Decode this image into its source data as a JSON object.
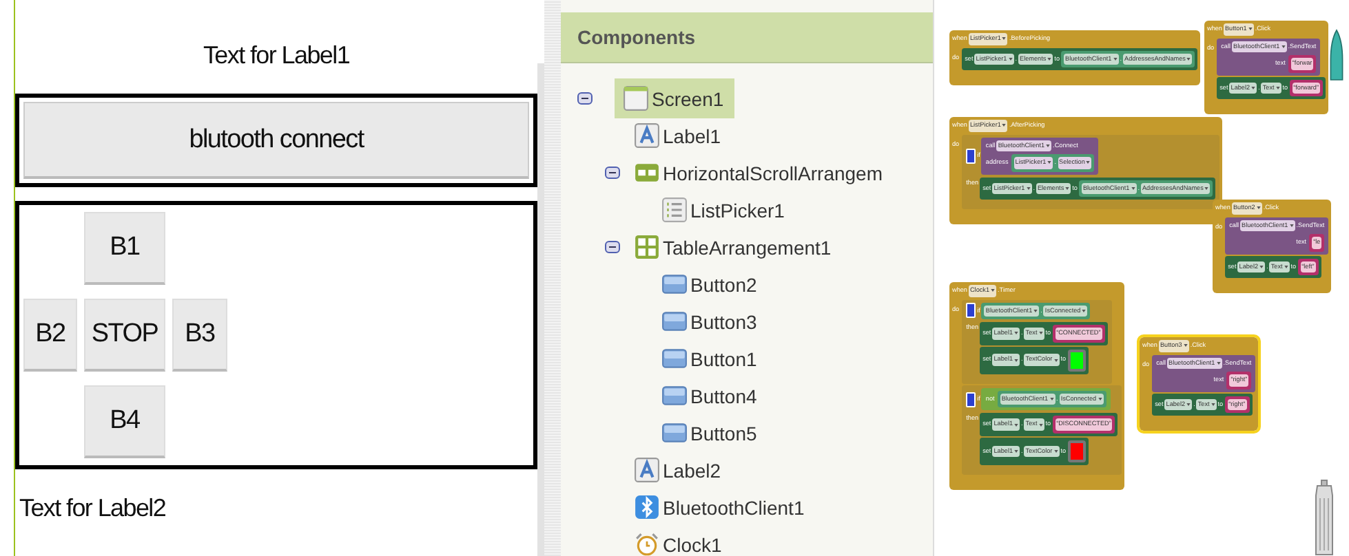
{
  "viewer": {
    "label1": "Text for Label1",
    "connect_button": "blutooth connect",
    "table_buttons": [
      "B1",
      "B2",
      "STOP",
      "B3",
      "B4"
    ],
    "label2": "Text for Label2"
  },
  "components": {
    "title": "Components",
    "tree": [
      {
        "name": "Screen1",
        "kind": "screen",
        "selected": true,
        "expanded": true,
        "children": [
          {
            "name": "Label1",
            "kind": "label",
            "selected": false
          },
          {
            "name": "HorizontalScrollArrangem",
            "kind": "horizontal",
            "selected": false,
            "expanded": true,
            "children": [
              {
                "name": "ListPicker1",
                "kind": "listpicker",
                "selected": false
              }
            ]
          },
          {
            "name": "TableArrangement1",
            "kind": "table",
            "selected": false,
            "expanded": true,
            "children": [
              {
                "name": "Button2",
                "kind": "button",
                "selected": false
              },
              {
                "name": "Button3",
                "kind": "button",
                "selected": false
              },
              {
                "name": "Button1",
                "kind": "button",
                "selected": false
              },
              {
                "name": "Button4",
                "kind": "button",
                "selected": false
              },
              {
                "name": "Button5",
                "kind": "button",
                "selected": false
              }
            ]
          },
          {
            "name": "Label2",
            "kind": "label",
            "selected": false
          },
          {
            "name": "BluetoothClient1",
            "kind": "bluetooth",
            "selected": false
          },
          {
            "name": "Clock1",
            "kind": "clock",
            "selected": false
          }
        ]
      }
    ]
  },
  "blocks": [
    {
      "selected": false,
      "head": [
        {
          "text": "when",
          "dropdown": false
        },
        {
          "text": "ListPicker1",
          "dropdown": true
        },
        {
          "text": ".BeforePicking",
          "dropdown": false
        }
      ],
      "do": "do",
      "body": [
        {
          "kind": "set",
          "tokens": [
            {
              "text": "set",
              "dropdown": false
            },
            {
              "text": "ListPicker1",
              "dropdown": true
            },
            {
              "text": ".",
              "dropdown": false
            },
            {
              "text": "Elements",
              "dropdown": true
            },
            {
              "text": "to",
              "dropdown": false
            }
          ],
          "value": {
            "kind": "getter",
            "tokens": [
              {
                "text": "BluetoothClient1",
                "dropdown": true
              },
              {
                "text": ".",
                "dropdown": false
              },
              {
                "text": "AddressesAndNames",
                "dropdown": true
              }
            ]
          }
        }
      ]
    },
    {
      "selected": false,
      "head": [
        {
          "text": "when",
          "dropdown": false
        },
        {
          "text": "ListPicker1",
          "dropdown": true
        },
        {
          "text": ".AfterPicking",
          "dropdown": false
        }
      ],
      "do": "do",
      "body": [
        {
          "kind": "if",
          "label": "if",
          "then": "then",
          "condition": {
            "kind": "call",
            "tokens": [
              {
                "text": "call",
                "dropdown": false
              },
              {
                "text": "BluetoothClient1",
                "dropdown": true
              },
              {
                "text": ".Connect",
                "dropdown": false
              }
            ],
            "args": [
              {
                "label": "address",
                "value": {
                  "kind": "getter",
                  "tokens": [
                    {
                      "text": "ListPicker1",
                      "dropdown": true
                    },
                    {
                      "text": ".",
                      "dropdown": false
                    },
                    {
                      "text": "Selection",
                      "dropdown": true
                    }
                  ]
                }
              }
            ]
          },
          "body": [
            {
              "kind": "set",
              "tokens": [
                {
                  "text": "set",
                  "dropdown": false
                },
                {
                  "text": "ListPicker1",
                  "dropdown": true
                },
                {
                  "text": ".",
                  "dropdown": false
                },
                {
                  "text": "Elements",
                  "dropdown": true
                },
                {
                  "text": "to",
                  "dropdown": false
                }
              ],
              "value": {
                "kind": "getter",
                "tokens": [
                  {
                    "text": "BluetoothClient1",
                    "dropdown": true
                  },
                  {
                    "text": ".",
                    "dropdown": false
                  },
                  {
                    "text": "AddressesAndNames",
                    "dropdown": true
                  }
                ]
              }
            }
          ]
        }
      ]
    },
    {
      "selected": false,
      "head": [
        {
          "text": "when",
          "dropdown": false
        },
        {
          "text": "Button1",
          "dropdown": true
        },
        {
          "text": ".Click",
          "dropdown": false
        }
      ],
      "do": "do",
      "body": [
        {
          "kind": "call",
          "tokens": [
            {
              "text": "call",
              "dropdown": false
            },
            {
              "text": "BluetoothClient1",
              "dropdown": true
            },
            {
              "text": ".SendText",
              "dropdown": false
            }
          ],
          "args": [
            {
              "label": "text",
              "value": {
                "kind": "text",
                "open": "“",
                "text": "forwar"
              }
            }
          ]
        },
        {
          "kind": "set",
          "tokens": [
            {
              "text": "set",
              "dropdown": false
            },
            {
              "text": "Label2",
              "dropdown": true
            },
            {
              "text": ".",
              "dropdown": false
            },
            {
              "text": "Text",
              "dropdown": true
            },
            {
              "text": "to",
              "dropdown": false
            }
          ],
          "value": {
            "kind": "text",
            "open": "“",
            "text": "forward",
            "close": "”"
          }
        }
      ]
    },
    {
      "selected": false,
      "head": [
        {
          "text": "when",
          "dropdown": false
        },
        {
          "text": "Button2",
          "dropdown": true
        },
        {
          "text": ".Click",
          "dropdown": false
        }
      ],
      "do": "do",
      "body": [
        {
          "kind": "call",
          "tokens": [
            {
              "text": "call",
              "dropdown": false
            },
            {
              "text": "BluetoothClient1",
              "dropdown": true
            },
            {
              "text": ".SendText",
              "dropdown": false
            }
          ],
          "args": [
            {
              "label": "text",
              "value": {
                "kind": "text",
                "open": "“",
                "text": "le"
              }
            }
          ]
        },
        {
          "kind": "set",
          "tokens": [
            {
              "text": "set",
              "dropdown": false
            },
            {
              "text": "Label2",
              "dropdown": true
            },
            {
              "text": ".",
              "dropdown": false
            },
            {
              "text": "Text",
              "dropdown": true
            },
            {
              "text": "to",
              "dropdown": false
            }
          ],
          "value": {
            "kind": "text",
            "open": "“",
            "text": "left",
            "close": "”"
          }
        }
      ]
    },
    {
      "selected": false,
      "head": [
        {
          "text": "when",
          "dropdown": false
        },
        {
          "text": "Clock1",
          "dropdown": true
        },
        {
          "text": ".Timer",
          "dropdown": false
        }
      ],
      "do": "do",
      "body": [
        {
          "kind": "if",
          "label": "if",
          "then": "then",
          "condition": {
            "kind": "getter",
            "tokens": [
              {
                "text": "BluetoothClient1",
                "dropdown": true
              },
              {
                "text": ".",
                "dropdown": false
              },
              {
                "text": "IsConnected",
                "dropdown": true
              }
            ]
          },
          "body": [
            {
              "kind": "set",
              "tokens": [
                {
                  "text": "set",
                  "dropdown": false
                },
                {
                  "text": "Label1",
                  "dropdown": true
                },
                {
                  "text": ".",
                  "dropdown": false
                },
                {
                  "text": "Text",
                  "dropdown": true
                },
                {
                  "text": "to",
                  "dropdown": false
                }
              ],
              "value": {
                "kind": "text",
                "open": "“",
                "text": "CONNECTED",
                "close": "”"
              }
            },
            {
              "kind": "set",
              "tokens": [
                {
                  "text": "set",
                  "dropdown": false
                },
                {
                  "text": "Label1",
                  "dropdown": true
                },
                {
                  "text": ".",
                  "dropdown": false
                },
                {
                  "text": "TextColor",
                  "dropdown": true
                },
                {
                  "text": "to",
                  "dropdown": false
                }
              ],
              "value": {
                "kind": "color",
                "color": "#00ff00"
              }
            }
          ]
        },
        {
          "kind": "if",
          "label": "if",
          "then": "then",
          "condition": {
            "kind": "not",
            "label": "not",
            "value": {
              "kind": "getter",
              "tokens": [
                {
                  "text": "BluetoothClient1",
                  "dropdown": true
                },
                {
                  "text": ".",
                  "dropdown": false
                },
                {
                  "text": "IsConnected",
                  "dropdown": true
                }
              ]
            }
          },
          "body": [
            {
              "kind": "set",
              "tokens": [
                {
                  "text": "set",
                  "dropdown": false
                },
                {
                  "text": "Label1",
                  "dropdown": true
                },
                {
                  "text": ".",
                  "dropdown": false
                },
                {
                  "text": "Text",
                  "dropdown": true
                },
                {
                  "text": "to",
                  "dropdown": false
                }
              ],
              "value": {
                "kind": "text",
                "open": "“",
                "text": "DISCONNECTED",
                "close": "”"
              }
            },
            {
              "kind": "set",
              "tokens": [
                {
                  "text": "set",
                  "dropdown": false
                },
                {
                  "text": "Label1",
                  "dropdown": true
                },
                {
                  "text": ".",
                  "dropdown": false
                },
                {
                  "text": "TextColor",
                  "dropdown": true
                },
                {
                  "text": "to",
                  "dropdown": false
                }
              ],
              "value": {
                "kind": "color",
                "color": "#ff0000"
              }
            }
          ]
        }
      ]
    },
    {
      "selected": true,
      "head": [
        {
          "text": "when",
          "dropdown": false
        },
        {
          "text": "Button3",
          "dropdown": true
        },
        {
          "text": ".Click",
          "dropdown": false
        }
      ],
      "do": "do",
      "body": [
        {
          "kind": "call",
          "tokens": [
            {
              "text": "call",
              "dropdown": false
            },
            {
              "text": "BluetoothClient1",
              "dropdown": true
            },
            {
              "text": ".SendText",
              "dropdown": false
            }
          ],
          "args": [
            {
              "label": "text",
              "value": {
                "kind": "text",
                "open": "“",
                "text": "right",
                "close": "”"
              }
            }
          ]
        },
        {
          "kind": "set",
          "tokens": [
            {
              "text": "set",
              "dropdown": false
            },
            {
              "text": "Label2",
              "dropdown": true
            },
            {
              "text": ".",
              "dropdown": false
            },
            {
              "text": "Text",
              "dropdown": true
            },
            {
              "text": "to",
              "dropdown": false
            }
          ],
          "value": {
            "kind": "text",
            "open": "“",
            "text": "right",
            "close": "”"
          }
        }
      ]
    }
  ]
}
